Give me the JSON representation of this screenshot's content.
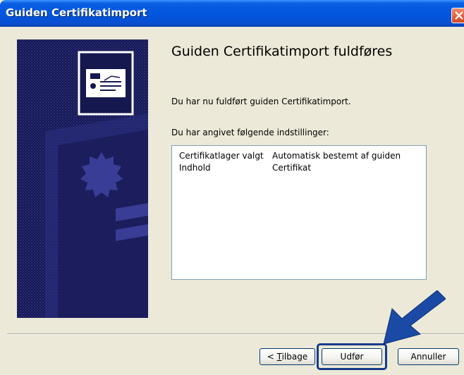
{
  "window": {
    "title": "Guiden Certifikatimport"
  },
  "icons": {
    "close": "close-icon",
    "certificate": "certificate-icon",
    "arrow": "arrow-pointer-icon"
  },
  "main": {
    "heading": "Guiden Certifikatimport fuldføres",
    "completed_text": "Du har nu fuldført guiden Certifikatimport.",
    "settings_text": "Du har angivet følgende indstillinger:",
    "settings": [
      {
        "key": "Certifikatlager valgt",
        "value": "Automatisk bestemt af guiden"
      },
      {
        "key": "Indhold",
        "value": "Certifikat"
      }
    ]
  },
  "buttons": {
    "back_prefix": "< ",
    "back_underline": "T",
    "back_rest": "ilbage",
    "finish": "Udfør",
    "cancel": "Annuller"
  },
  "colors": {
    "titlebar": "#0056e0",
    "banner": "#161854",
    "highlight": "#143c8c",
    "dialog_background": "#ece9d8"
  }
}
